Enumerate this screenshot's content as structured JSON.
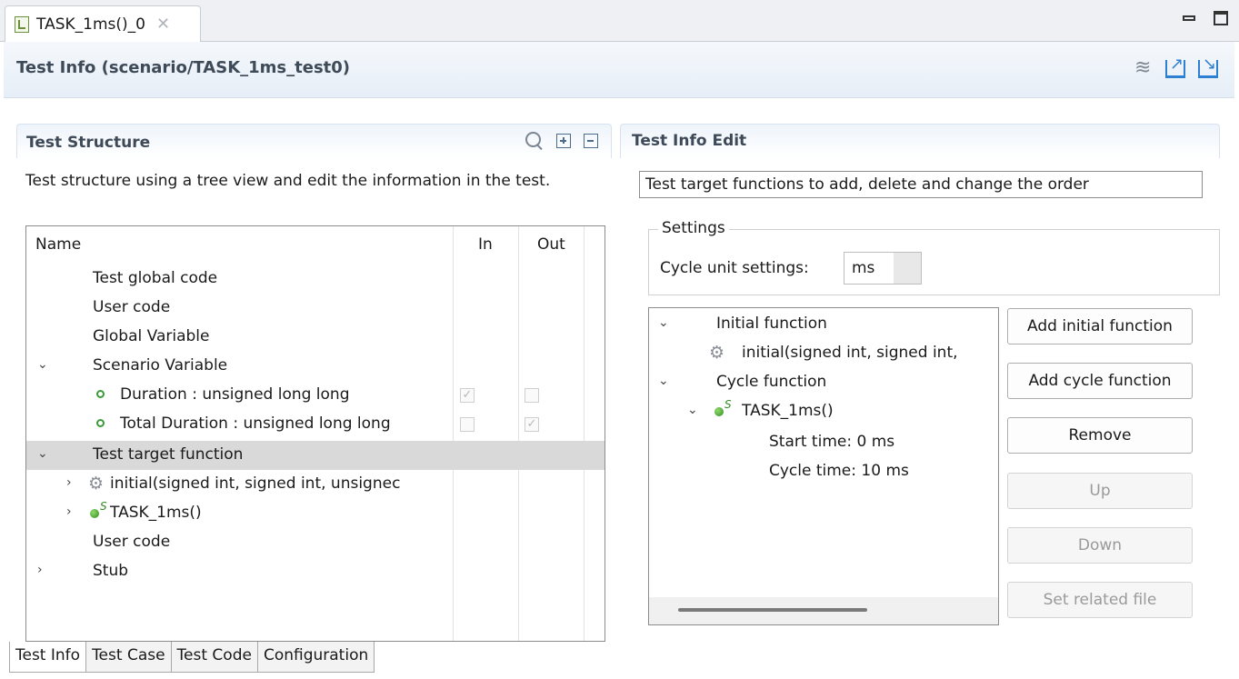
{
  "editor_tab": {
    "title": "TASK_1ms()_0"
  },
  "header": {
    "title": "Test Info (scenario/TASK_1ms_test0)"
  },
  "test_structure": {
    "title": "Test Structure",
    "description": "Test structure using a tree view and edit the information in the test.",
    "columns": {
      "name": "Name",
      "in": "In",
      "out": "Out"
    },
    "rows": [
      {
        "label": "Test global code"
      },
      {
        "label": "User code"
      },
      {
        "label": "Global Variable"
      },
      {
        "label": "Scenario Variable",
        "expanded": true
      },
      {
        "label": "Duration  :  unsigned long long",
        "in_checked": true,
        "out_checked": false
      },
      {
        "label": "Total Duration  :  unsigned long long",
        "in_checked": false,
        "out_checked": true
      },
      {
        "label": "Test target function",
        "expanded": true,
        "selected": true
      },
      {
        "label": "initial(signed int, signed int, unsignec"
      },
      {
        "label": "TASK_1ms()"
      },
      {
        "label": "User code"
      },
      {
        "label": "Stub"
      }
    ]
  },
  "test_info_edit": {
    "title": "Test Info Edit",
    "target_description": "Test target functions to add, delete and change the order",
    "settings": {
      "legend": "Settings",
      "cycle_label": "Cycle unit settings:",
      "cycle_unit": "ms"
    },
    "function_tree": [
      {
        "label": "Initial function"
      },
      {
        "label": "initial(signed int, signed int,"
      },
      {
        "label": "Cycle function"
      },
      {
        "label": "TASK_1ms()"
      },
      {
        "label": "Start time: 0 ms"
      },
      {
        "label": "Cycle time: 10 ms"
      }
    ],
    "buttons": {
      "add_initial": "Add initial function",
      "add_cycle": "Add cycle function",
      "remove": "Remove",
      "up": "Up",
      "down": "Down",
      "set_related": "Set related file"
    }
  },
  "bottom_tabs": [
    "Test Info",
    "Test Case",
    "Test Code",
    "Configuration"
  ],
  "icon_names": [
    "file-icon",
    "close-icon",
    "minimize-icon",
    "maximize-icon",
    "layers-icon",
    "export-icon",
    "import-icon",
    "search-icon",
    "expand-all-icon",
    "collapse-all-icon",
    "chevron-down-icon",
    "chevron-right-icon",
    "gear-icon",
    "green-dot-icon",
    "task-icon"
  ],
  "colors": {
    "header_text": "#3e4a58",
    "selection": "#d9d9d9",
    "accent": "#2c7fd1"
  }
}
